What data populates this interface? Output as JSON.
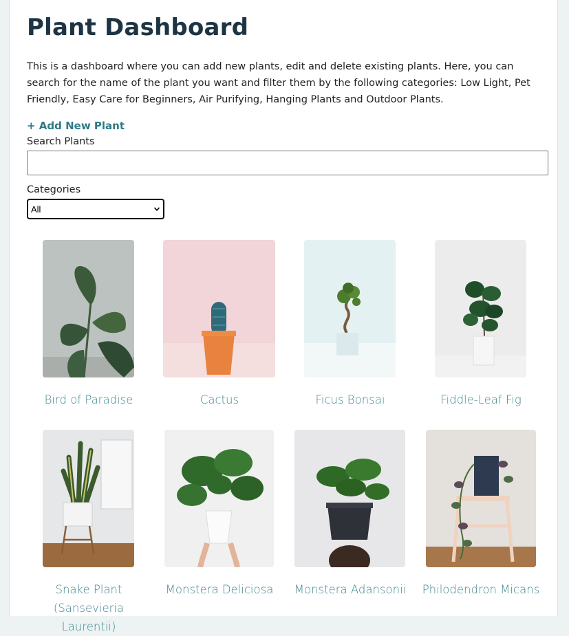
{
  "header": {
    "title": "Plant Dashboard",
    "description": "This is a dashboard where you can add new plants, edit and delete existing plants. Here, you can search for the name of the plant you want and filter them by the following categories: Low Light, Pet Friendly, Easy Care for Beginners, Air Purifying, Hanging Plants and Outdoor Plants."
  },
  "actions": {
    "add_plant_label": "+ Add New Plant"
  },
  "search": {
    "label": "Search Plants",
    "value": "",
    "placeholder": ""
  },
  "filter": {
    "label": "Categories",
    "selected": "All"
  },
  "plants": [
    {
      "name": "Bird of Paradise",
      "icon": "bird-of-paradise-photo"
    },
    {
      "name": "Cactus",
      "icon": "cactus-photo"
    },
    {
      "name": "Ficus Bonsai",
      "icon": "ficus-bonsai-photo"
    },
    {
      "name": "Fiddle-Leaf Fig",
      "icon": "fiddle-leaf-fig-photo"
    },
    {
      "name": "Snake Plant (Sansevieria Laurentii)",
      "icon": "snake-plant-photo"
    },
    {
      "name": "Monstera Deliciosa",
      "icon": "monstera-deliciosa-photo"
    },
    {
      "name": "Monstera Adansonii",
      "icon": "monstera-adansonii-photo"
    },
    {
      "name": "Philodendron Micans",
      "icon": "philodendron-micans-photo"
    }
  ],
  "colors": {
    "title": "#1d3444",
    "accent": "#2e7a86",
    "plant_name": "#3f8690"
  }
}
